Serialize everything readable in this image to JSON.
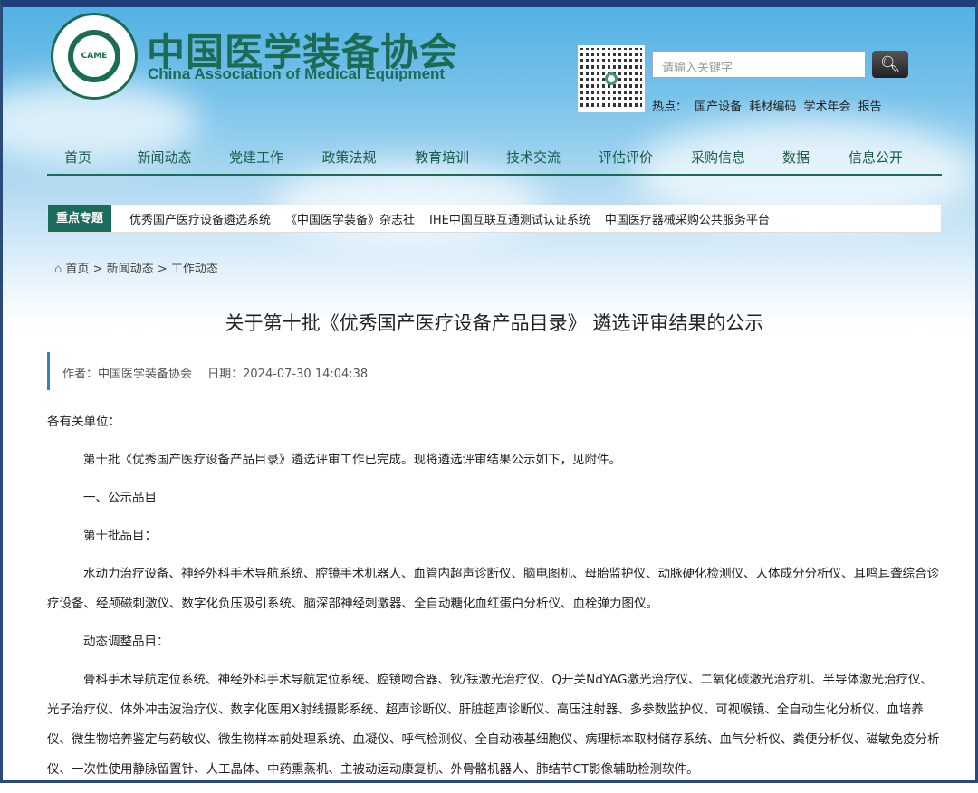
{
  "header": {
    "logo_text": "CAME",
    "title_cn": "中国医学装备协会",
    "title_en": "China Association of Medical Equipment"
  },
  "search": {
    "placeholder": "请输入关键字"
  },
  "hot": {
    "label": "热点：",
    "items": [
      "国产设备",
      "耗材编码",
      "学术年会",
      "报告"
    ]
  },
  "nav": [
    "首页",
    "新闻动态",
    "党建工作",
    "政策法规",
    "教育培训",
    "技术交流",
    "评估评价",
    "采购信息",
    "数据",
    "信息公开"
  ],
  "topics": {
    "label": "重点专题",
    "items": [
      "优秀国产医疗设备遴选系统",
      "《中国医学装备》杂志社",
      "IHE中国互联互通测试认证系统",
      "中国医疗器械采购公共服务平台"
    ]
  },
  "breadcrumb": [
    "首页",
    ">",
    "新闻动态",
    ">",
    "工作动态"
  ],
  "article": {
    "title": "关于第十批《优秀国产医疗设备产品目录》 遴选评审结果的公示",
    "meta": "作者：中国医学装备协会　 日期：2024-07-30 14:04:38",
    "paragraphs": [
      "各有关单位：",
      "第十批《优秀国产医疗设备产品目录》遴选评审工作已完成。现将遴选评审结果公示如下，见附件。",
      "一、公示品目",
      "第十批品目：",
      "水动力治疗设备、神经外科手术导航系统、腔镜手术机器人、血管内超声诊断仪、脑电图机、母胎监护仪、动脉硬化检测仪、人体成分分析仪、耳鸣耳聋综合诊疗设备、经颅磁刺激仪、数字化负压吸引系统、脑深部神经刺激器、全自动糖化血红蛋白分析仪、血栓弹力图仪。",
      "动态调整品目：",
      "骨科手术导航定位系统、神经外科手术导航定位系统、腔镜吻合器、钬/铥激光治疗仪、Q开关NdYAG激光治疗仪、二氧化碳激光治疗机、半导体激光治疗仪、光子治疗仪、体外冲击波治疗仪、数字化医用X射线摄影系统、超声诊断仪、肝脏超声诊断仪、高压注射器、多参数监护仪、可视喉镜、全自动生化分析仪、血培养仪、微生物培养鉴定与药敏仪、微生物样本前处理系统、血凝仪、呼气检测仪、全自动液基细胞仪、病理标本取材储存系统、血气分析仪、粪便分析仪、磁敏免疫分析仪、一次性使用静脉留置针、人工晶体、中药熏蒸机、主被动运动康复机、外骨骼机器人、肺结节CT影像辅助检测软件。"
    ]
  }
}
